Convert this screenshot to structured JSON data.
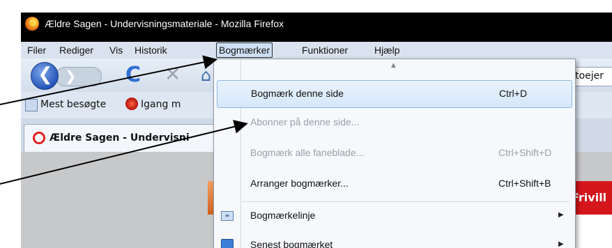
{
  "window": {
    "title": "Ældre Sagen - Undervisningsmateriale - Mozilla Firefox",
    "icon": "firefox-icon"
  },
  "menubar": {
    "items": [
      {
        "label": "Filer"
      },
      {
        "label": "Rediger"
      },
      {
        "label": "Vis"
      },
      {
        "label": "Historik"
      },
      {
        "label": "Bogmærker",
        "active": true
      },
      {
        "label": "Funktioner"
      },
      {
        "label": "Hjælp"
      }
    ]
  },
  "navbar": {
    "back_glyph": "❮",
    "forward_glyph": "❯",
    "reload_glyph": "C",
    "stop_glyph": "✕",
    "home_glyph": "⌂",
    "url_fragment": "ktoejer"
  },
  "bookmarks_toolbar": {
    "items": [
      {
        "label": "Mest besøgte",
        "icon": "most-visited-icon"
      },
      {
        "label": "Igang m",
        "icon": "getting-started-icon"
      }
    ]
  },
  "tab": {
    "label": "Ældre Sagen - Undervisni",
    "icon": "aeldre-sagen-icon"
  },
  "content": {
    "right_heading_fragment": "Frivill"
  },
  "bookmarks_menu": {
    "scroll_glyph": "▲",
    "submenu_glyph": "▶",
    "items": [
      {
        "label": "Bogmærk denne side",
        "shortcut": "Ctrl+D",
        "highlighted": true
      },
      {
        "label": "Abonner på denne side...",
        "shortcut": "",
        "disabled": true
      },
      {
        "label": "Bogmærk alle faneblade...",
        "shortcut": "Ctrl+Shift+D",
        "disabled": true
      },
      {
        "label": "Arranger bogmærker...",
        "shortcut": "Ctrl+Shift+B"
      },
      {
        "label": "Bogmærkelinje",
        "icon": "bookmarks-toolbar-icon",
        "submenu": true,
        "icon_text": "≡"
      },
      {
        "label": "Senest bogmærket",
        "icon": "recent-bookmarks-icon",
        "submenu": true
      }
    ]
  },
  "colors": {
    "titlebar": "#000000",
    "menubar": "#d9e2ee",
    "highlight": "#d5e7fb",
    "red_banner": "#d5161c"
  }
}
